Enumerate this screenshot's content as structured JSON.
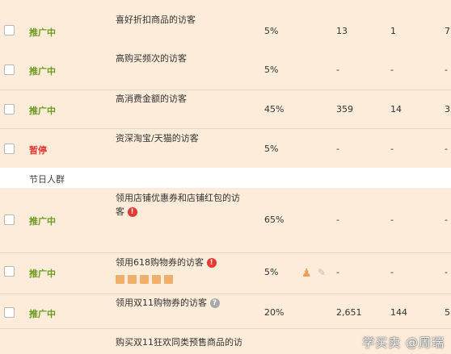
{
  "rows": [
    {
      "status": "推广中",
      "name": "喜好折扣商品的访客",
      "pct": "5%",
      "c1": "13",
      "c2": "1",
      "c3": "7"
    },
    {
      "status": "推广中",
      "name": "高购买频次的访客",
      "pct": "5%",
      "c1": "-",
      "c2": "-",
      "c3": "-"
    },
    {
      "status": "推广中",
      "name": "高消费金额的访客",
      "pct": "45%",
      "c1": "359",
      "c2": "14",
      "c3": "3"
    },
    {
      "status": "暂停",
      "name": "资深淘宝/天猫的访客",
      "pct": "5%",
      "c1": "-",
      "c2": "-",
      "c3": "-"
    },
    {
      "status": "推广中",
      "name": "领用店铺优惠券和店铺红包的访客",
      "pct": "65%",
      "c1": "-",
      "c2": "-",
      "c3": "-"
    },
    {
      "status": "推广中",
      "name": "领用618购物券的访客",
      "pct": "5%",
      "c1": "-",
      "c2": "-",
      "c3": "-"
    },
    {
      "status": "推广中",
      "name": "领用双11购物券的访客",
      "pct": "20%",
      "c1": "2,651",
      "c2": "144",
      "c3": "5"
    },
    {
      "status": "",
      "name": "购买双11狂欢同类预售商品的访",
      "pct": "",
      "c1": "",
      "c2": "",
      "c3": ""
    }
  ],
  "group_label": "节日人群",
  "icons": {
    "info_red": "!",
    "info_gray": "?"
  },
  "watermark": "学买卖 @周瑞",
  "colors": {
    "row_bg": "#fcecd9",
    "active": "#6a9a1e",
    "paused": "#e53935"
  }
}
